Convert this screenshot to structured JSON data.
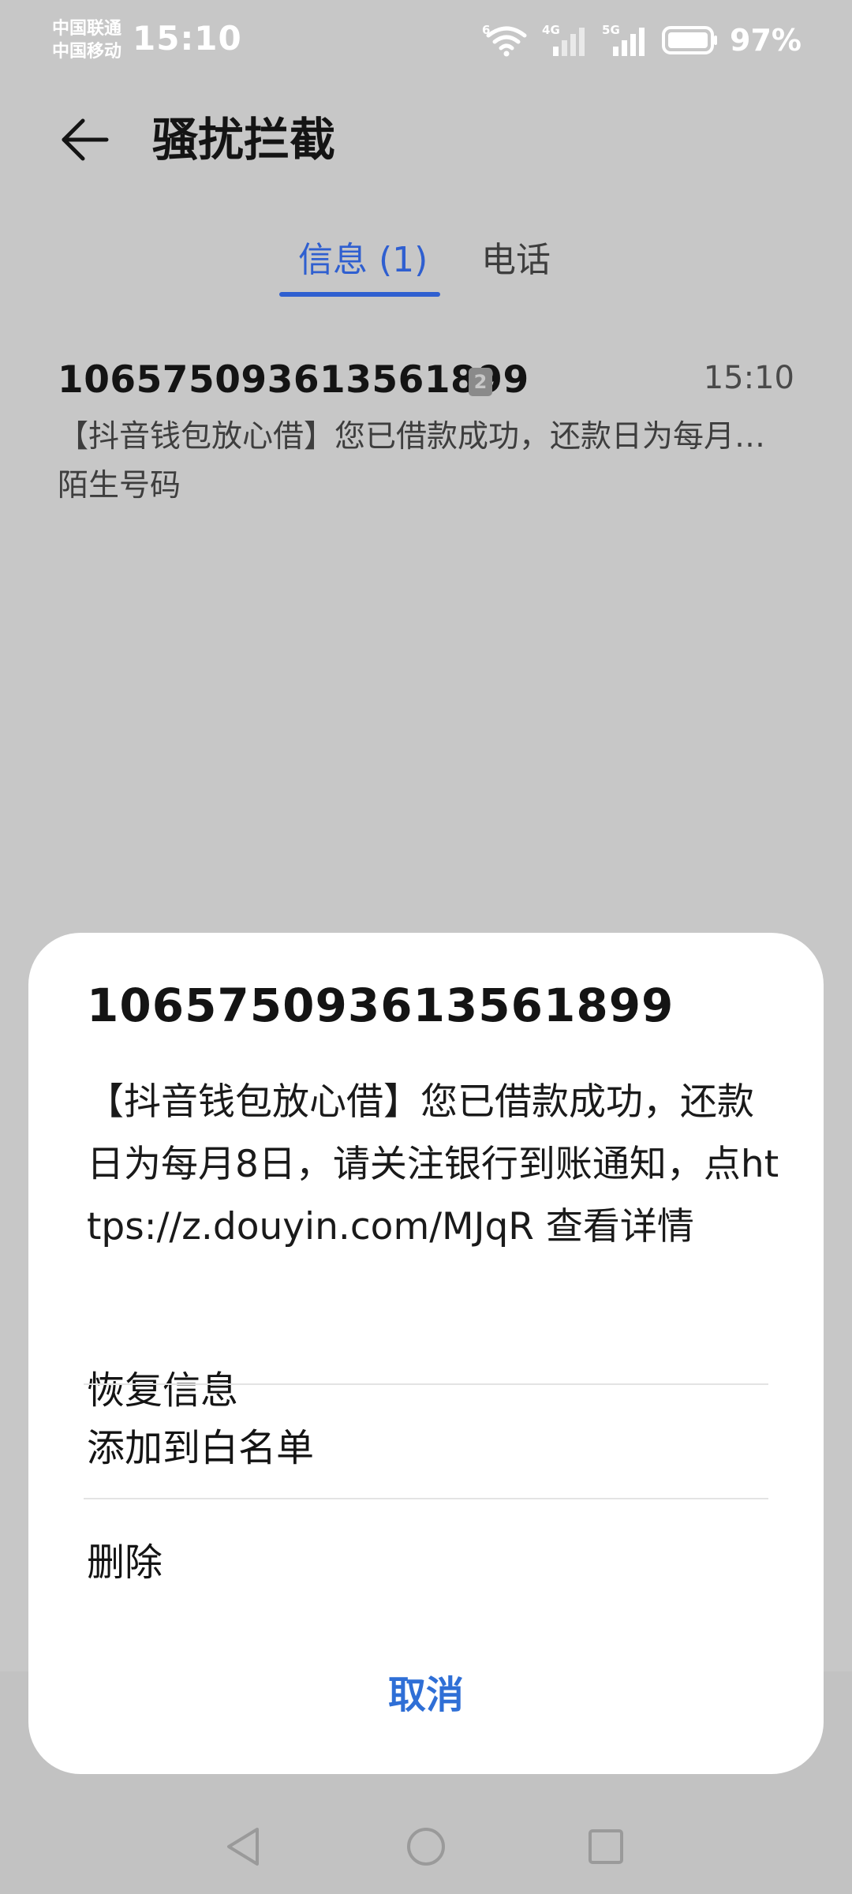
{
  "status_bar": {
    "carrier_1": "中国联通",
    "carrier_2": "中国移动",
    "time": "15:10",
    "wifi_tag": "6",
    "sim1_network": "4G",
    "sim2_network": "5G",
    "battery_percent": "97%",
    "icons": [
      "wifi-icon",
      "signal-icon",
      "signal-icon",
      "battery-icon"
    ]
  },
  "header": {
    "back_icon": "back-arrow-icon",
    "title": "骚扰拦截"
  },
  "tabs": [
    {
      "label": "信息 (1)",
      "selected": true
    },
    {
      "label": "电话",
      "selected": false
    }
  ],
  "message_list": [
    {
      "number": "1065750936135618​99",
      "sim_badge": "2",
      "time": "15:10",
      "preview": "【抖音钱包放心借】您已借款成功，还款日为每月…",
      "tag": "陌生号码"
    }
  ],
  "dialog": {
    "title": "106575093613561899",
    "body": "【抖音钱包放心借】您已借款成功，还款日为每月8日，请关注银行到账通知，点https://z.douyin.com/MJqR 查看详情",
    "options": [
      "恢复信息",
      "添加到白名单",
      "删除"
    ],
    "cancel": "取消"
  },
  "nav_bar": {
    "icons": [
      "back-triangle-icon",
      "home-circle-icon",
      "recents-square-icon"
    ]
  },
  "colors": {
    "accent": "#2f5fd0",
    "cancel": "#2f6fd6",
    "dim_background": "#c7c7c7",
    "dialog": "#ffffff"
  }
}
